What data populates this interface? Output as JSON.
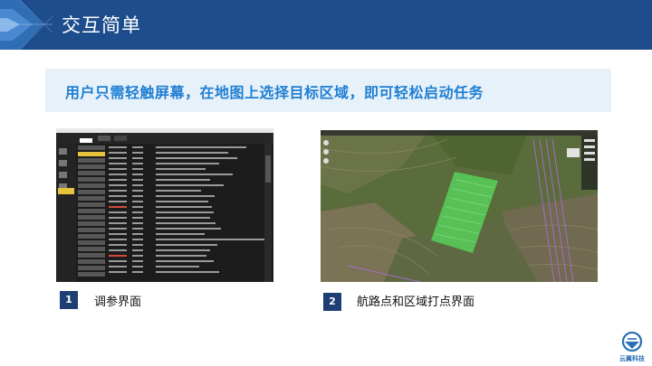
{
  "header": {
    "title": "交互简单"
  },
  "banner": {
    "text": "用户只需轻触屏幕，在地图上选择目标区域，即可轻松启动任务"
  },
  "items": [
    {
      "number": "1",
      "caption": "调参界面"
    },
    {
      "number": "2",
      "caption": "航路点和区域打点界面"
    }
  ],
  "logo": {
    "text": "云翼科技"
  },
  "colors": {
    "header": "#1d4d8c",
    "banner_bg": "#e7f1fa",
    "banner_text": "#1f7fd2",
    "badge": "#1d3f73"
  }
}
